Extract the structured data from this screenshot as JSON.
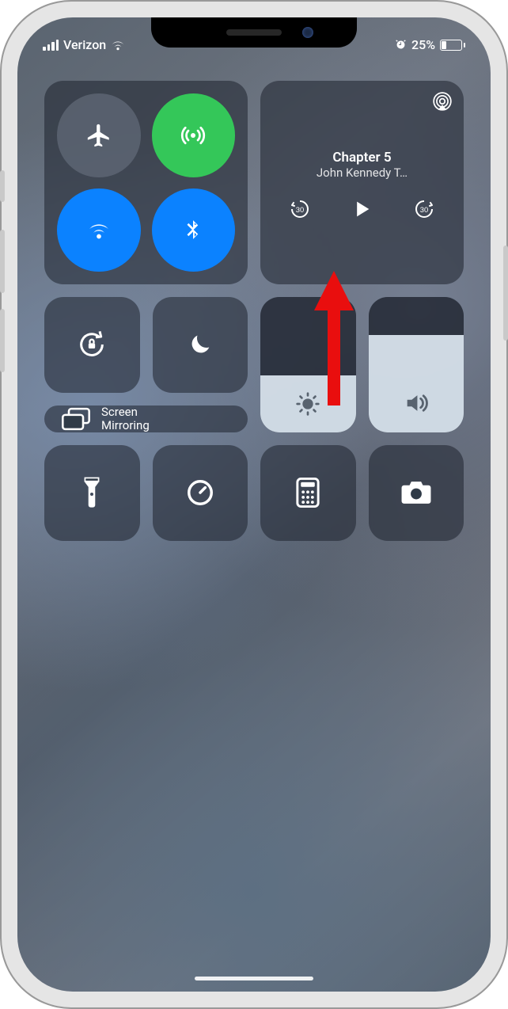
{
  "status": {
    "carrier": "Verizon",
    "battery_text": "25%",
    "battery_pct": 25
  },
  "connectivity": {
    "airplane": "off",
    "cellular": "on",
    "wifi": "on",
    "bluetooth": "on"
  },
  "media": {
    "title": "Chapter 5",
    "subtitle": "John Kennedy T…",
    "skip_back_seconds": "30",
    "skip_fwd_seconds": "30"
  },
  "screen_mirroring": {
    "label": "Screen\nMirroring"
  },
  "sliders": {
    "brightness_pct": 42,
    "volume_pct": 72
  }
}
